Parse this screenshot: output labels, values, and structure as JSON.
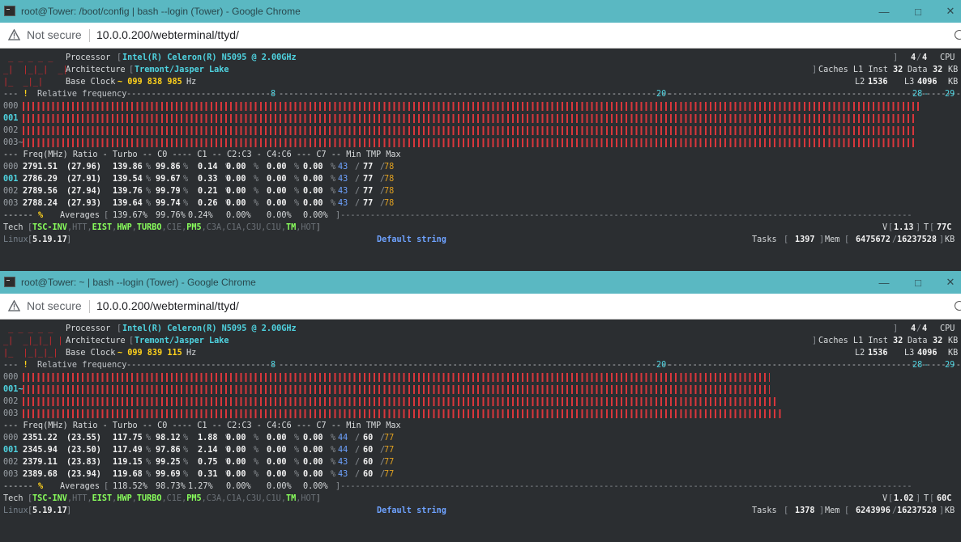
{
  "windows": [
    {
      "title": "root@Tower: /boot/config | bash --login (Tower) - Google Chrome",
      "not_secure": "Not secure",
      "url": "10.0.0.200/webterminal/ttyd/",
      "processor_label": "Processor",
      "processor": "Intel(R) Celeron(R) N5095 @ 2.00GHz",
      "cpu_count": "4",
      "cpu_total": "4",
      "cpu_label": "CPU",
      "arch_label": "Architecture",
      "arch": "Tremont/Jasper Lake",
      "caches_label": "Caches L1 Inst",
      "l1_inst": "32",
      "data_label": "Data",
      "l1_data": "32",
      "kb": "KB",
      "baseclock_label": "Base Clock",
      "baseclock": "~ 099 838 985",
      "hz": "Hz",
      "l2_label": "L2",
      "l2": "1536",
      "l3_label": "L3",
      "l3": "4096",
      "relfreq": "Relative frequency",
      "mark_8": "8",
      "mark_20": "20",
      "mark_28": "28",
      "mark_29": "29",
      "bars": [
        {
          "cpu": "000",
          "fraction": 0.976
        },
        {
          "cpu": "001",
          "fraction": 0.972
        },
        {
          "cpu": "002",
          "fraction": 0.972
        },
        {
          "cpu": "003~",
          "fraction": 0.972
        }
      ],
      "header": "--- Freq(MHz) Ratio - Turbo -- C0 ---- C1 -- C2:C3 - C4:C6 --- C7 -- Min TMP Max",
      "rows": [
        {
          "cpu": "000",
          "freq": "2791.51",
          "ratio": "(27.96)",
          "turbo": "139.86",
          "c0": "99.86",
          "c1": "0.14",
          "c3": "0.00",
          "c6": "0.00",
          "c7": "0.00",
          "min": "43",
          "tmp": "77",
          "max": "78"
        },
        {
          "cpu": "001",
          "freq": "2786.29",
          "ratio": "(27.91)",
          "turbo": "139.54",
          "c0": "99.67",
          "c1": "0.33",
          "c3": "0.00",
          "c6": "0.00",
          "c7": "0.00",
          "min": "43",
          "tmp": "77",
          "max": "78"
        },
        {
          "cpu": "002",
          "freq": "2789.56",
          "ratio": "(27.94)",
          "turbo": "139.76",
          "c0": "99.79",
          "c1": "0.21",
          "c3": "0.00",
          "c6": "0.00",
          "c7": "0.00",
          "min": "43",
          "tmp": "77",
          "max": "78"
        },
        {
          "cpu": "003",
          "freq": "2788.24",
          "ratio": "(27.93)",
          "turbo": "139.64",
          "c0": "99.74",
          "c1": "0.26",
          "c3": "0.00",
          "c6": "0.00",
          "c7": "0.00",
          "min": "43",
          "tmp": "77",
          "max": "78"
        }
      ],
      "avg": {
        "turbo": "139.67%",
        "c0": "99.76%",
        "c1": "0.24%",
        "c3": "0.00%",
        "c6": "0.00%",
        "c7": "0.00%"
      },
      "avg_label": "Averages",
      "tech_label": "Tech",
      "volt": "1.13",
      "temp": "77C",
      "linux_label": "Linux",
      "kernel": "5.19.17",
      "board": "Default string",
      "tasks_label": "Tasks",
      "tasks": "1397",
      "mem_label": "Mem",
      "mem": "6475672",
      "mem_total": "16237528",
      "mem_unit": "KB"
    },
    {
      "title": "root@Tower: ~ | bash --login (Tower) - Google Chrome",
      "not_secure": "Not secure",
      "url": "10.0.0.200/webterminal/ttyd/",
      "processor_label": "Processor",
      "processor": "Intel(R) Celeron(R) N5095 @ 2.00GHz",
      "cpu_count": "4",
      "cpu_total": "4",
      "cpu_label": "CPU",
      "arch_label": "Architecture",
      "arch": "Tremont/Jasper Lake",
      "caches_label": "Caches L1 Inst",
      "l1_inst": "32",
      "data_label": "Data",
      "l1_data": "32",
      "kb": "KB",
      "baseclock_label": "Base Clock",
      "baseclock": "~ 099 839 115",
      "hz": "Hz",
      "l2_label": "L2",
      "l2": "1536",
      "l3_label": "L3",
      "l3": "4096",
      "relfreq": "Relative frequency",
      "mark_8": "8",
      "mark_20": "20",
      "mark_28": "28",
      "mark_29": "29",
      "bars": [
        {
          "cpu": "000",
          "fraction": 0.812
        },
        {
          "cpu": "001~",
          "fraction": 0.812
        },
        {
          "cpu": "002",
          "fraction": 0.821
        },
        {
          "cpu": "003",
          "fraction": 0.826
        }
      ],
      "header": "--- Freq(MHz) Ratio - Turbo -- C0 ---- C1 -- C2:C3 - C4:C6 --- C7 -- Min TMP Max",
      "rows": [
        {
          "cpu": "000",
          "freq": "2351.22",
          "ratio": "(23.55)",
          "turbo": "117.75",
          "c0": "98.12",
          "c1": "1.88",
          "c3": "0.00",
          "c6": "0.00",
          "c7": "0.00",
          "min": "44",
          "tmp": "60",
          "max": "77"
        },
        {
          "cpu": "001",
          "freq": "2345.94",
          "ratio": "(23.50)",
          "turbo": "117.49",
          "c0": "97.86",
          "c1": "2.14",
          "c3": "0.00",
          "c6": "0.00",
          "c7": "0.00",
          "min": "44",
          "tmp": "60",
          "max": "77"
        },
        {
          "cpu": "002",
          "freq": "2379.11",
          "ratio": "(23.83)",
          "turbo": "119.15",
          "c0": "99.25",
          "c1": "0.75",
          "c3": "0.00",
          "c6": "0.00",
          "c7": "0.00",
          "min": "43",
          "tmp": "60",
          "max": "77"
        },
        {
          "cpu": "003",
          "freq": "2389.68",
          "ratio": "(23.94)",
          "turbo": "119.68",
          "c0": "99.69",
          "c1": "0.31",
          "c3": "0.00",
          "c6": "0.00",
          "c7": "0.00",
          "min": "43",
          "tmp": "60",
          "max": "77"
        }
      ],
      "avg": {
        "turbo": "118.52%",
        "c0": "98.73%",
        "c1": "1.27%",
        "c3": "0.00%",
        "c6": "0.00%",
        "c7": "0.00%"
      },
      "avg_label": "Averages",
      "tech_label": "Tech",
      "volt": "1.02",
      "temp": "60C",
      "linux_label": "Linux",
      "kernel": "5.19.17",
      "board": "Default string",
      "tasks_label": "Tasks",
      "tasks": "1378",
      "mem_label": "Mem",
      "mem": "6243996",
      "mem_total": "16237528",
      "mem_unit": "KB"
    }
  ],
  "tech_flags": [
    {
      "name": "TSC-INV",
      "on": true
    },
    {
      "name": "HTT",
      "on": false
    },
    {
      "name": "EIST",
      "on": true
    },
    {
      "name": "HWP",
      "on": true
    },
    {
      "name": "TURBO",
      "on": true
    },
    {
      "name": "C1E",
      "on": false
    },
    {
      "name": "PM5",
      "on": true
    },
    {
      "name": "C3A",
      "on": false
    },
    {
      "name": "C1A",
      "on": false
    },
    {
      "name": "C3U",
      "on": false
    },
    {
      "name": "C1U",
      "on": false
    },
    {
      "name": "TM",
      "on": true
    },
    {
      "name": "HOT",
      "on": false
    }
  ],
  "icons": {
    "warning": "not-secure-warning-icon",
    "minimize": "minimize-icon",
    "maximize": "maximize-icon",
    "close": "close-icon"
  },
  "colors": {
    "titlebar": "#5ab8c2",
    "terminal_bg": "#2b2e31",
    "bar": "#d9363b",
    "cyan": "#4fd3e0",
    "green": "#89ff5c",
    "yellow": "#ffd21c"
  }
}
